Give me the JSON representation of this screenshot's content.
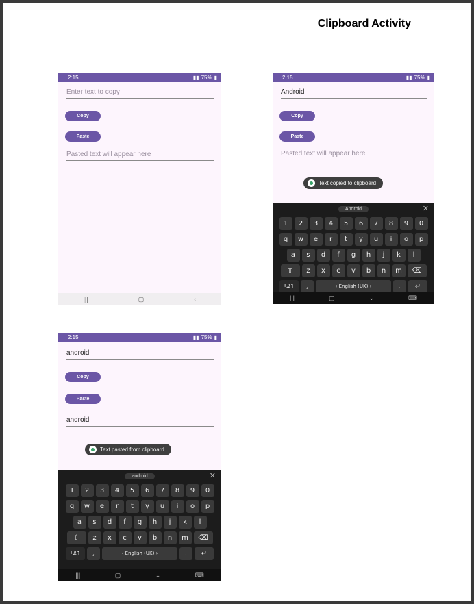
{
  "document": {
    "title": "Clipboard Activity"
  },
  "status": {
    "time": "2:15",
    "battery": "75%"
  },
  "screens": [
    {
      "input": {
        "value": "",
        "placeholder": "Enter text to copy"
      },
      "copy_label": "Copy",
      "paste_label": "Paste",
      "output": {
        "value": "",
        "placeholder": "Pasted text will appear here"
      }
    },
    {
      "input": {
        "value": "Android",
        "placeholder": "Enter text to copy"
      },
      "copy_label": "Copy",
      "paste_label": "Paste",
      "output": {
        "value": "",
        "placeholder": "Pasted text will appear here"
      },
      "toast": "Text copied to clipboard",
      "suggestion": "Android"
    },
    {
      "input": {
        "value": "android",
        "placeholder": "Enter text to copy"
      },
      "copy_label": "Copy",
      "paste_label": "Paste",
      "output": {
        "value": "android",
        "placeholder": "Pasted text will appear here"
      },
      "toast": "Text pasted from clipboard",
      "suggestion": "android"
    }
  ],
  "keyboard": {
    "numbers": [
      "1",
      "2",
      "3",
      "4",
      "5",
      "6",
      "7",
      "8",
      "9",
      "0"
    ],
    "row1": [
      "q",
      "w",
      "e",
      "r",
      "t",
      "y",
      "u",
      "i",
      "o",
      "p"
    ],
    "row2": [
      "a",
      "s",
      "d",
      "f",
      "g",
      "h",
      "j",
      "k",
      "l"
    ],
    "row3": [
      "z",
      "x",
      "c",
      "v",
      "b",
      "n",
      "m"
    ],
    "symbols_key": "!#1",
    "comma_key": ",",
    "space_label": "English (UK)",
    "period_key": "."
  },
  "icons": {
    "shift": "shift-icon",
    "backspace": "backspace-icon",
    "enter": "enter-icon",
    "recents": "recents-icon",
    "home": "home-icon",
    "back": "back-icon"
  },
  "colors": {
    "accent": "#6b56a6",
    "background": "#fdf5fd",
    "keyboard": "#1c1c1c"
  }
}
